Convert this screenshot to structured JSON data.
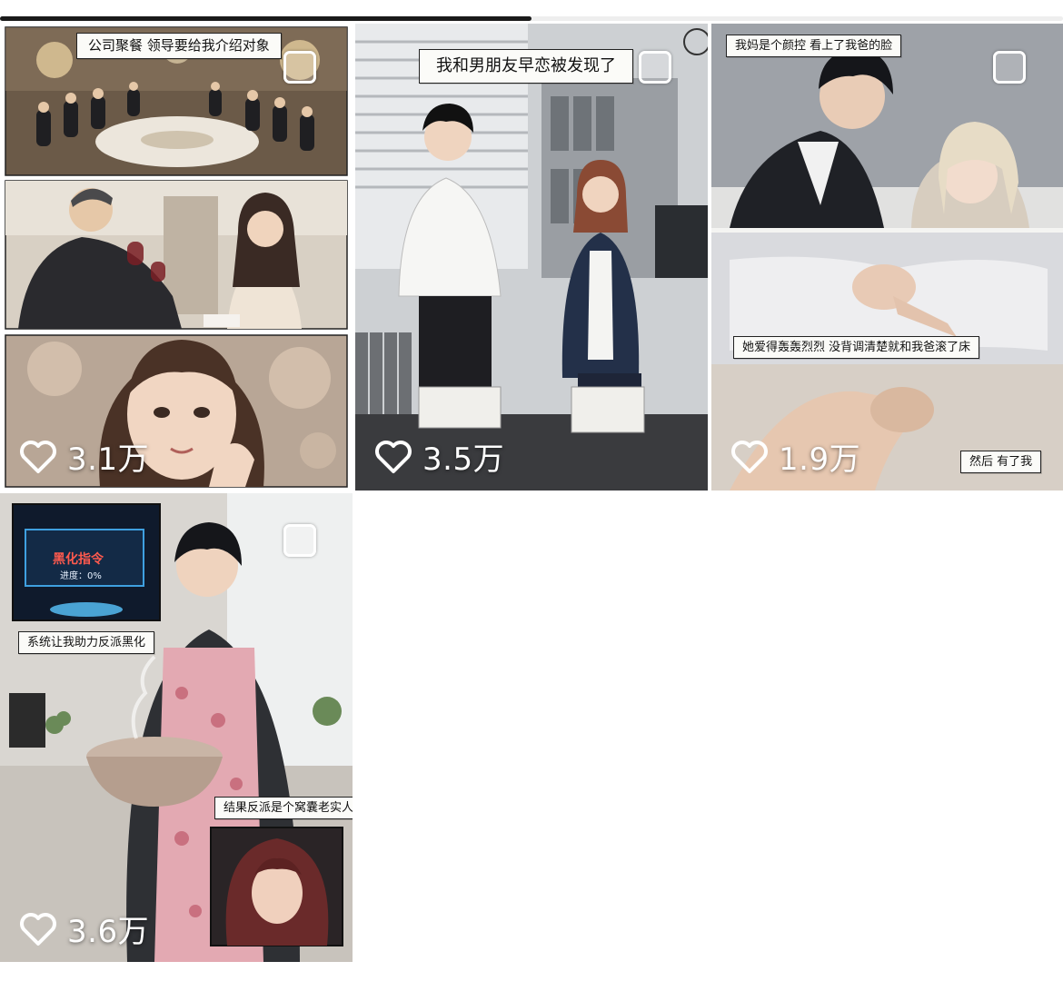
{
  "progress": {
    "fraction": 0.5
  },
  "tiles": [
    {
      "captions": [
        "公司聚餐 领导要给我介绍对象"
      ],
      "likes": "3.1万"
    },
    {
      "captions": [
        "我和男朋友早恋被发现了"
      ],
      "likes": "3.5万"
    },
    {
      "captions": [
        "我妈是个颜控 看上了我爸的脸",
        "她爱得轰轰烈烈 没背调清楚就和我爸滚了床",
        "然后 有了我"
      ],
      "likes": "1.9万"
    },
    {
      "captions": [
        "系统让我助力反派黑化",
        "结果反派是个窝囊老实人"
      ],
      "screen_title": "黑化指令",
      "screen_progress": "进度：0%",
      "likes": "3.6万"
    }
  ],
  "colors": {
    "accent": "#1a1a1a",
    "overlay_text": "#ffffff",
    "warning": "#e23b3b"
  },
  "icons": {
    "like": "heart-outline-icon",
    "select": "checkbox-outline-icon"
  }
}
